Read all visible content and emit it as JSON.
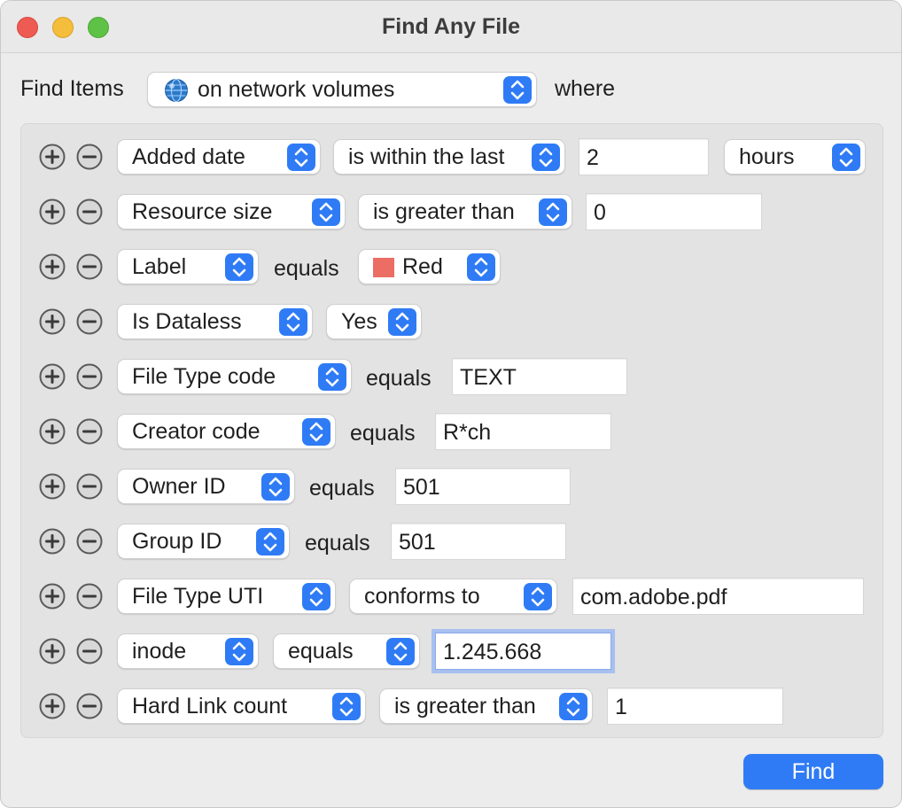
{
  "window": {
    "title": "Find Any File"
  },
  "header": {
    "find_items_label": "Find Items",
    "scope_value": "on network volumes",
    "where_label": "where"
  },
  "rows": [
    {
      "field": "Added date",
      "operator": "is within the last",
      "value": "2",
      "unit": "hours"
    },
    {
      "field": "Resource size",
      "operator": "is greater than",
      "value": "0"
    },
    {
      "field": "Label",
      "operator": "equals",
      "value": "Red",
      "value_color": "#eb6d64"
    },
    {
      "field": "Is Dataless",
      "value": "Yes"
    },
    {
      "field": "File Type code",
      "operator": "equals",
      "value": "TEXT"
    },
    {
      "field": "Creator code",
      "operator": "equals",
      "value": "R*ch"
    },
    {
      "field": "Owner ID",
      "operator": "equals",
      "value": "501"
    },
    {
      "field": "Group ID",
      "operator": "equals",
      "value": "501"
    },
    {
      "field": "File Type UTI",
      "operator": "conforms to",
      "value": "com.adobe.pdf"
    },
    {
      "field": "inode",
      "operator": "equals",
      "value": "1.245.668"
    },
    {
      "field": "Hard Link count",
      "operator": "is greater than",
      "value": "1"
    }
  ],
  "footer": {
    "find_button": "Find"
  },
  "colors": {
    "accent": "#2f7bf5",
    "focus_ring": "#a7c0f0",
    "close": "#ee5b52",
    "minimize": "#f4bd3b",
    "maximize": "#5ec246"
  },
  "icons": {
    "scope": "globe-icon",
    "add": "plus-circle-icon",
    "remove": "minus-circle-icon",
    "popup": "chevron-updown-icon"
  }
}
